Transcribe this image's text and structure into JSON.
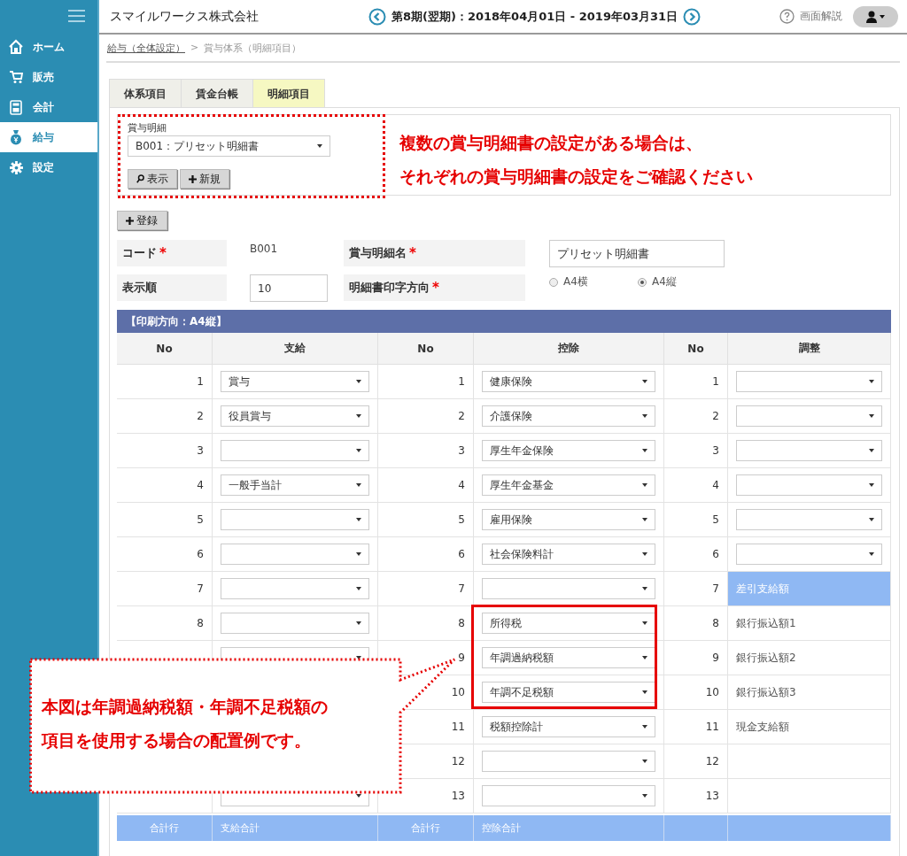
{
  "sidebar": {
    "items": [
      {
        "label": "ホーム",
        "selected": false
      },
      {
        "label": "販売",
        "selected": false
      },
      {
        "label": "会計",
        "selected": false
      },
      {
        "label": "給与",
        "selected": true
      },
      {
        "label": "設定",
        "selected": false
      }
    ]
  },
  "header": {
    "company": "スマイルワークス株式会社",
    "period": "第8期(翌期)：2018年04月01日 - 2019年03月31日",
    "help": "画面解説"
  },
  "breadcrumb": {
    "link": "給与（全体設定）",
    "separator": ">",
    "current": "賞与体系（明細項目）"
  },
  "tabs": [
    {
      "label": "体系項目",
      "selected": false
    },
    {
      "label": "賃金台帳",
      "selected": false
    },
    {
      "label": "明細項目",
      "selected": true
    }
  ],
  "selector": {
    "label": "賞与明細",
    "value": "B001：プリセット明細書",
    "buttons": [
      "表示",
      "新規"
    ]
  },
  "note": {
    "lines": [
      "複数の賞与明細書の設定がある場合は、",
      "それぞれの賞与明細書の設定をご確認ください"
    ]
  },
  "register_button": "登録",
  "form": {
    "code": {
      "label": "コード",
      "mark": "*",
      "value": "B001"
    },
    "name": {
      "label": "賞与明細名",
      "mark": "*",
      "value": "プリセット明細書"
    },
    "order": {
      "label": "表示順",
      "value": "10"
    },
    "orientation": {
      "label": "明細書印字方向",
      "mark": "*",
      "options": [
        {
          "label": "A4横",
          "selected": false
        },
        {
          "label": "A4縦",
          "selected": true
        }
      ]
    }
  },
  "table": {
    "title": "【印刷方向：A4縦】",
    "columns": [
      "No",
      "支給",
      "No",
      "控除",
      "No",
      "調整"
    ],
    "rows": [
      {
        "pay_no": "1",
        "pay": {
          "kind": "select",
          "value": "賞与"
        },
        "deduction_no": "1",
        "deduction": {
          "kind": "select",
          "value": "健康保険"
        },
        "adjust_no": "1",
        "adjust": {
          "kind": "select"
        },
        "highlighted": false
      },
      {
        "pay_no": "2",
        "pay": {
          "kind": "select",
          "value": "役員賞与"
        },
        "deduction_no": "2",
        "deduction": {
          "kind": "select",
          "value": "介護保険"
        },
        "adjust_no": "2",
        "adjust": {
          "kind": "select"
        },
        "highlighted": false
      },
      {
        "pay_no": "3",
        "pay": {
          "kind": "select"
        },
        "deduction_no": "3",
        "deduction": {
          "kind": "select",
          "value": "厚生年金保険"
        },
        "adjust_no": "3",
        "adjust": {
          "kind": "select"
        },
        "highlighted": false
      },
      {
        "pay_no": "4",
        "pay": {
          "kind": "select",
          "value": "一般手当計"
        },
        "deduction_no": "4",
        "deduction": {
          "kind": "select",
          "value": "厚生年金基金"
        },
        "adjust_no": "4",
        "adjust": {
          "kind": "select"
        },
        "highlighted": false
      },
      {
        "pay_no": "5",
        "pay": {
          "kind": "select"
        },
        "deduction_no": "5",
        "deduction": {
          "kind": "select",
          "value": "雇用保険"
        },
        "adjust_no": "5",
        "adjust": {
          "kind": "select"
        },
        "highlighted": false
      },
      {
        "pay_no": "6",
        "pay": {
          "kind": "select"
        },
        "deduction_no": "6",
        "deduction": {
          "kind": "select",
          "value": "社会保険料計"
        },
        "adjust_no": "6",
        "adjust": {
          "kind": "select"
        },
        "highlighted": false
      },
      {
        "pay_no": "7",
        "pay": {
          "kind": "select"
        },
        "deduction_no": "7",
        "deduction": {
          "kind": "select"
        },
        "adjust_no": "7",
        "adjust": {
          "kind": "total",
          "text": "差引支給額"
        },
        "highlighted": false
      },
      {
        "pay_no": "8",
        "pay": {
          "kind": "select"
        },
        "deduction_no": "8",
        "deduction": {
          "kind": "select",
          "value": "所得税"
        },
        "adjust_no": "8",
        "adjust": {
          "kind": "text",
          "text": "銀行振込額1"
        },
        "highlighted": true
      },
      {
        "pay": {
          "kind": "select"
        },
        "deduction_no": "9",
        "deduction": {
          "kind": "select",
          "value": "年調過納税額"
        },
        "adjust_no": "9",
        "adjust": {
          "kind": "text",
          "text": "銀行振込額2"
        },
        "highlighted": true
      },
      {
        "deduction_no": "10",
        "deduction": {
          "kind": "select",
          "value": "年調不足税額"
        },
        "adjust_no": "10",
        "adjust": {
          "kind": "text",
          "text": "銀行振込額3"
        },
        "highlighted": true
      },
      {
        "deduction_no": "11",
        "deduction": {
          "kind": "select",
          "value": "税額控除計"
        },
        "adjust_no": "11",
        "adjust": {
          "kind": "text",
          "text": "現金支給額"
        },
        "highlighted": false
      },
      {
        "deduction_no": "12",
        "deduction": {
          "kind": "select"
        },
        "adjust_no": "12",
        "highlighted": false
      },
      {
        "pay": {
          "kind": "select"
        },
        "deduction_no": "13",
        "deduction": {
          "kind": "select"
        },
        "adjust_no": "13",
        "highlighted": false
      }
    ],
    "footer": [
      "合計行",
      "支給合計",
      "合計行",
      "控除合計"
    ]
  },
  "callout": {
    "lines": [
      "本図は年調過納税額・年調不足税額の",
      "項目を使用する場合の配置例です。"
    ]
  }
}
